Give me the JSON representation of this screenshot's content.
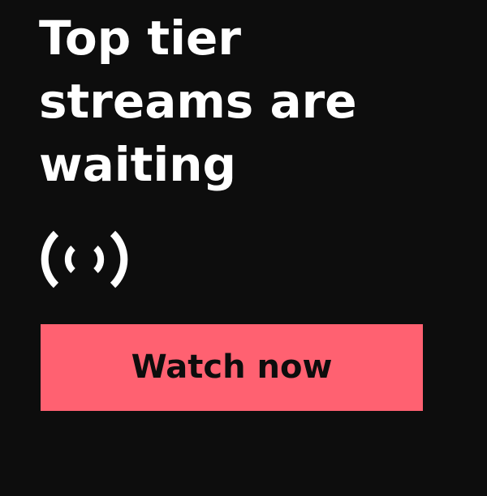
{
  "ad": {
    "headline_lines": [
      "Top tier",
      "streams are",
      "waiting"
    ],
    "icon": "live-broadcast-icon",
    "cta_label": "Watch now"
  },
  "colors": {
    "background": "#0d0d0d",
    "text": "#ffffff",
    "cta_background": "#ff6171",
    "cta_text": "#0d0d0d"
  }
}
